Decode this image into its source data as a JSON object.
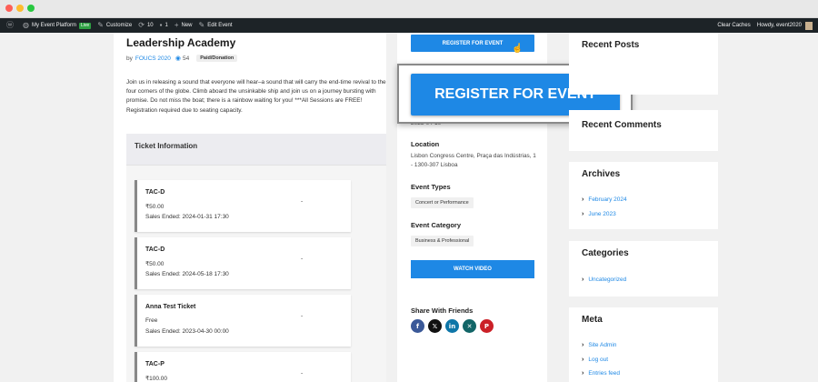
{
  "adminbar": {
    "site_name": "My Event Platform",
    "live_badge": "Live",
    "customize": "Customize",
    "updates_count": "10",
    "comments_count": "1",
    "new_label": "New",
    "edit_event": "Edit Event",
    "clear_caches": "Clear Caches",
    "howdy": "Howdy, event2020"
  },
  "event": {
    "title": "Leadership Academy",
    "by_label": "by",
    "organizer": "FOUCS 2020",
    "views": "54",
    "type_tag": "Paid/Donation",
    "description": "Join us in releasing a sound that everyone will hear–a sound that will carry the end-time revival to the four corners of the globe. Climb aboard the unsinkable ship and join us on a journey bursting with promise. Do not miss the boat; there is a rainbow waiting for you! ***All Sessions are FREE! Registration required due to seating capacity."
  },
  "tickets": {
    "heading": "Ticket Information",
    "items": [
      {
        "name": "TAC-D",
        "price": "₹50.00",
        "sales": "Sales Ended: 2024-01-31 17:30",
        "qty": "-"
      },
      {
        "name": "TAC-D",
        "price": "₹50.00",
        "sales": "Sales Ended: 2024-05-18 17:30",
        "qty": "-"
      },
      {
        "name": "Anna Test Ticket",
        "price": "Free",
        "sales": "Sales Ended: 2023-04-30 00:00",
        "qty": "-"
      },
      {
        "name": "TAC-P",
        "price": "₹100.00",
        "sales": "",
        "qty": "-"
      }
    ]
  },
  "event_sidebar": {
    "register_label": "REGISTER FOR EVENT",
    "register_big_label": "REGISTER FOR EVENT",
    "date_peek": "2023-04-10",
    "location_label": "Location",
    "location_text": "Lisbon Congress Centre, Praça das Indústrias, 1 - 1300-307 Lisboa",
    "types_label": "Event Types",
    "type_chip": "Concert or Performance",
    "category_label": "Event Category",
    "category_chip": "Business & Professional",
    "watch_label": "WATCH VIDEO",
    "share_label": "Share With Friends"
  },
  "widgets": {
    "recent_posts": "Recent Posts",
    "recent_comments": "Recent Comments",
    "archives": {
      "title": "Archives",
      "items": [
        "February 2024",
        "June 2023"
      ]
    },
    "categories": {
      "title": "Categories",
      "items": [
        "Uncategorized"
      ]
    },
    "meta": {
      "title": "Meta",
      "items": [
        "Site Admin",
        "Log out",
        "Entries feed"
      ]
    }
  },
  "colors": {
    "accent": "#1e88e5",
    "adminbar": "#1d2327",
    "facebook": "#3b5998",
    "x": "#111111",
    "linkedin": "#0e76a8",
    "xing": "#126567",
    "pinterest": "#cb2027"
  }
}
